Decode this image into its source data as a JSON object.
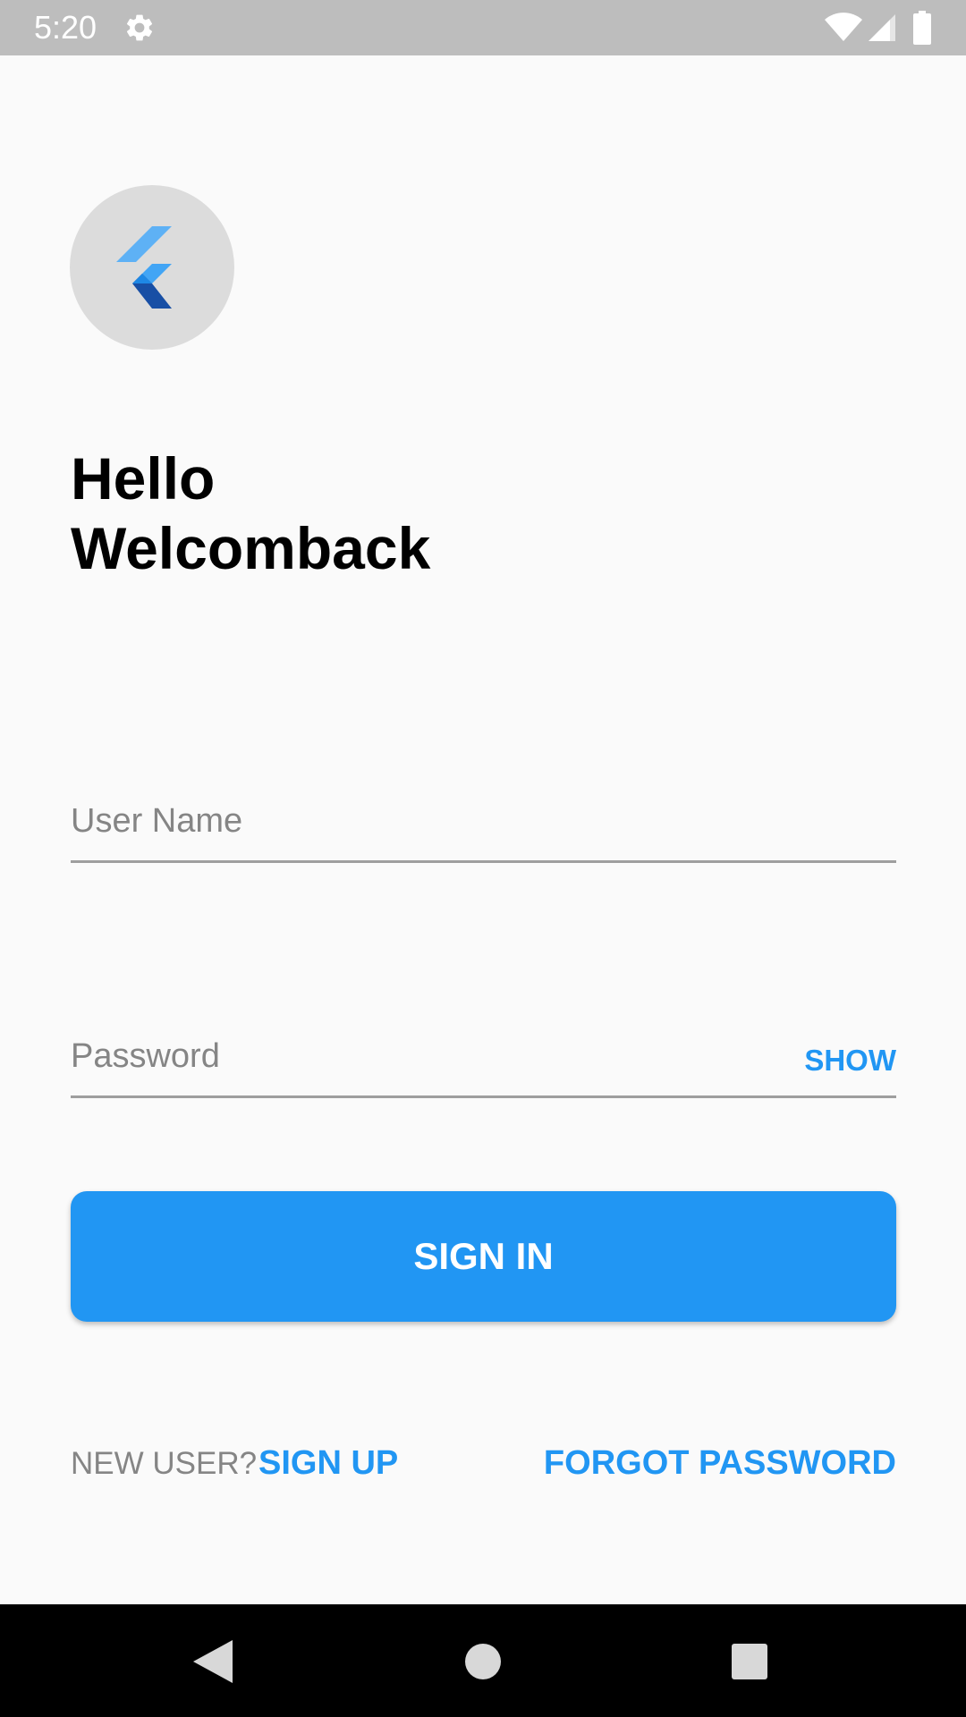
{
  "status_bar": {
    "time": "5:20",
    "icons": [
      "gear-icon",
      "wifi-icon",
      "signal-icon",
      "battery-icon"
    ]
  },
  "logo": {
    "icon": "flutter-logo-icon"
  },
  "greeting": {
    "line1": "Hello",
    "line2": "Welcomback"
  },
  "form": {
    "username_label": "User Name",
    "password_label": "Password",
    "show_label": "SHOW",
    "signin_label": "SIGN IN"
  },
  "footer": {
    "new_user_label": "NEW USER?",
    "signup_label": "SIGN UP",
    "forgot_label": "FORGOT PASSWORD"
  },
  "nav_bar": {
    "icons": [
      "back-icon",
      "home-icon",
      "recents-icon"
    ]
  },
  "colors": {
    "accent": "#2196f3",
    "status_bar": "#bdbdbd",
    "background": "#fafafa",
    "nav_bar": "#000000",
    "muted_text": "#858585"
  }
}
